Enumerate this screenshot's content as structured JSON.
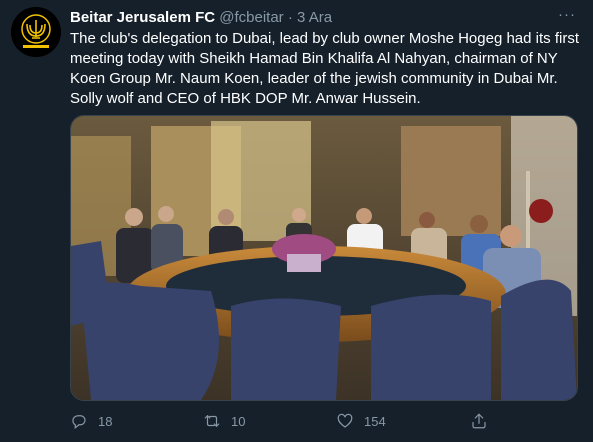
{
  "tweet": {
    "display_name": "Beitar Jerusalem FC",
    "handle": "@fcbeitar",
    "separator": "·",
    "time": "3 Ara",
    "more_label": "···",
    "text": "The club's delegation to Dubai, lead by club owner Moshe Hogeg had its first meeting today with Sheikh Hamad Bin Khalifa Al Nahyan, chairman of NY Koen Group Mr. Naum Koen, leader of the jewish community in Dubai Mr. Solly wolf and CEO of HBK DOP Mr. Anwar Hussein.",
    "avatar_icon": "beitar-menorah-crest",
    "media_description_icon": "meeting-photo"
  },
  "actions": {
    "reply_count": "18",
    "retweet_count": "10",
    "like_count": "154"
  },
  "colors": {
    "background": "#15202b",
    "secondary_text": "#8899a6",
    "avatar_gold": "#f2c200"
  }
}
